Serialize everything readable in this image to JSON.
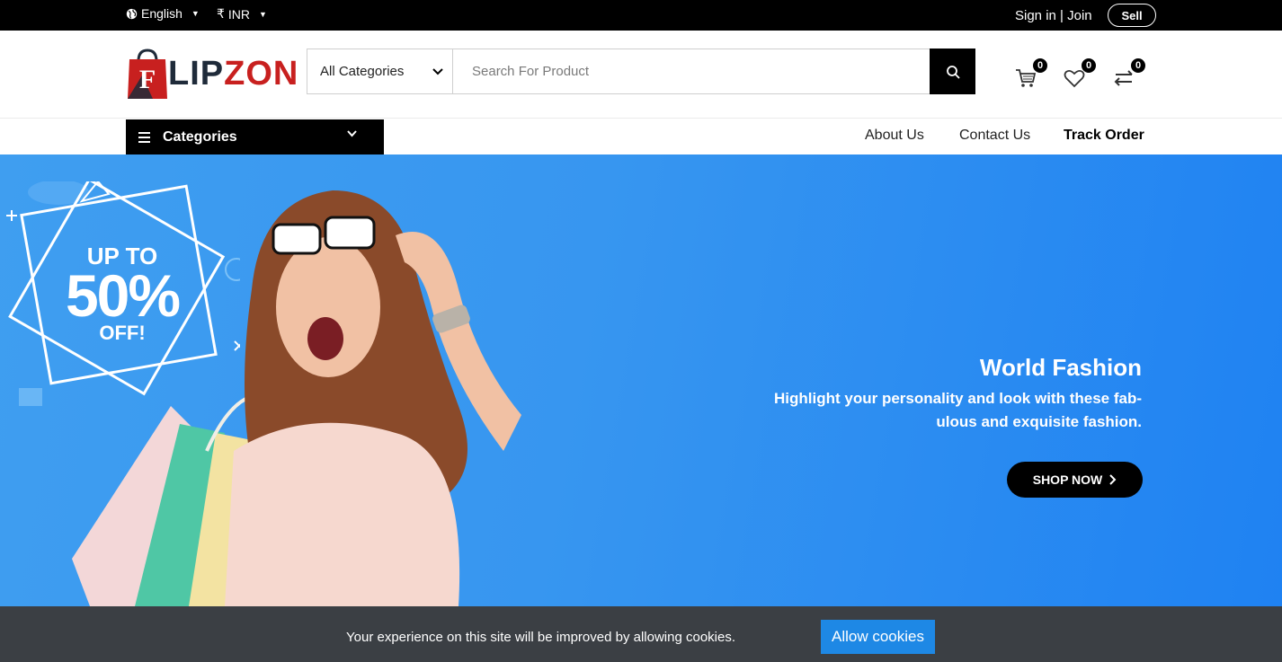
{
  "topbar": {
    "language": "English",
    "currency_symbol": "₹",
    "currency": "INR",
    "sign_in": "Sign in",
    "separator": "|",
    "join": "Join",
    "sell": "Sell"
  },
  "header": {
    "logo_letter": "F",
    "logo_text_dark": "LIP",
    "logo_text_red": "ZON",
    "category_select": "All Categories",
    "search_placeholder": "Search For Product",
    "cart_count": "0",
    "wishlist_count": "0",
    "compare_count": "0"
  },
  "nav": {
    "categories": "Categories",
    "links": [
      "About Us",
      "Contact Us",
      "Track Order"
    ]
  },
  "hero": {
    "promo_line1": "UP TO",
    "promo_line2": "50%",
    "promo_line3": "OFF!",
    "title": "World Fashion",
    "subtitle": "Highlight your personality and look with these fab-ulous and exquisite fashion.",
    "button": "SHOP NOW"
  },
  "cookie": {
    "message": "Your experience on this site will be improved by allowing cookies.",
    "button": "Allow cookies"
  },
  "colors": {
    "hero_blue": "#3796f0",
    "brand_red": "#c8201f",
    "brand_dark": "#1f2b3a",
    "cookie_button": "#1e88e5"
  }
}
